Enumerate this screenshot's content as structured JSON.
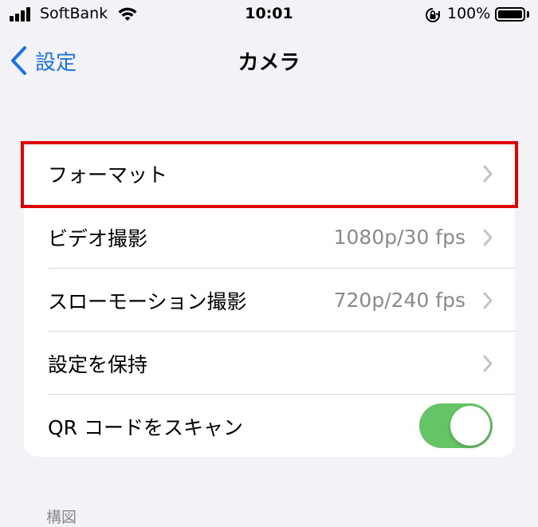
{
  "status_bar": {
    "carrier": "SoftBank",
    "time": "10:01",
    "battery_percent": "100%",
    "icons": [
      "signal-icon",
      "wifi-icon",
      "orientation-lock-icon",
      "battery-icon"
    ]
  },
  "nav": {
    "back_label": "設定",
    "title": "カメラ"
  },
  "settings": {
    "rows": [
      {
        "label": "フォーマット",
        "value": ""
      },
      {
        "label": "ビデオ撮影",
        "value": "1080p/30 fps"
      },
      {
        "label": "スローモーション撮影",
        "value": "720p/240 fps"
      },
      {
        "label": "設定を保持",
        "value": ""
      },
      {
        "label": "QR コードをスキャン",
        "toggle_on": true
      }
    ]
  },
  "section_footer": "構図",
  "colors": {
    "accent": "#1a73e8",
    "toggle_on": "#65c466",
    "highlight": "#e00000",
    "background": "#f2f2f7"
  }
}
